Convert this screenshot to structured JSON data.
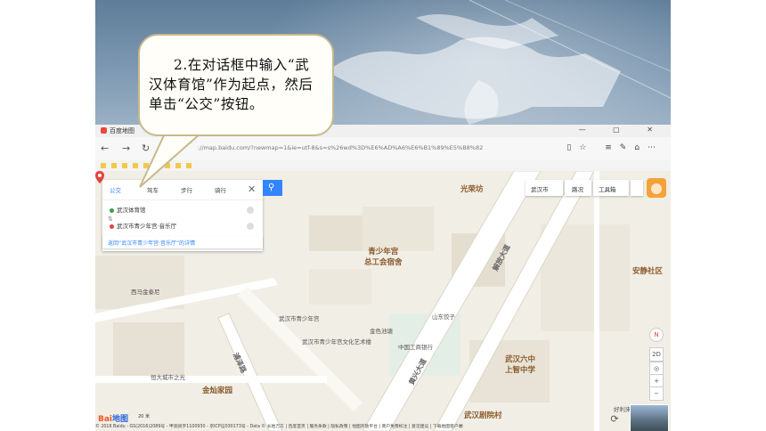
{
  "instruction": {
    "text": "2.在对话框中输入“武汉体育馆”作为起点，然后单击“公交”按钮。"
  },
  "browser": {
    "tab_title": "百度地图",
    "url": "://map.baidu.com/?newmap=1&ie=utf-8&s=s%26wd%3D%E6%AD%A6%E6%B1%89%E5%B8%82",
    "window_controls": "—  ▢  ✕"
  },
  "route_panel": {
    "modes": [
      "公交",
      "驾车",
      "步行",
      "骑行"
    ],
    "active_mode": "公交",
    "start_value": "武汉体育馆",
    "end_value": "武汉市青少年宫·音乐厅",
    "detail_link": "返回“武汉市青少年宫·音乐厅”的详情"
  },
  "top_controls": {
    "city": "武汉市",
    "traffic": "路况",
    "toolbox": "工具箱"
  },
  "map_labels": {
    "district1": "光荣坊",
    "district2": "青少年宫\n总工会宿舍",
    "district3": "安静社区",
    "district4": "金灿家园",
    "district5": "武汉六中\n上智中学",
    "district6": "武汉剧院村",
    "road1": "解放大道",
    "road2": "黄兴大道",
    "road3": "浦泽路",
    "poi_main": "武汉市青少年宫",
    "poi1": "武汉市青少年宫文化艺术楼",
    "poi2": "金色池塘",
    "poi3": "山东饺子",
    "poi4": "中国工商银行",
    "poi5": "好利来蛋糕",
    "poi6": "西马金泰尼",
    "poi7": "恒大城市之光"
  },
  "map_controls": {
    "compass": "N",
    "mode_2d": "2D",
    "zoom_in": "+",
    "zoom_out": "−"
  },
  "footer": {
    "logo_text": "Bai",
    "logo_suffix": "地图",
    "scale": "20 米",
    "copyright": "© 2016 Baidu - GS(2016)2089号 - 甲测资字1100930 - 京ICP证030173号 - Data © 长地万方 | 百度首页 | 服务条款 | 隐私政策 | 地图开放平台 | 商户免费标注 | 意见建议 | 下载地图客户端"
  },
  "colors": {
    "accent": "#3385ff",
    "bubble_border": "#c7b98a",
    "pin": "#e2453c"
  }
}
